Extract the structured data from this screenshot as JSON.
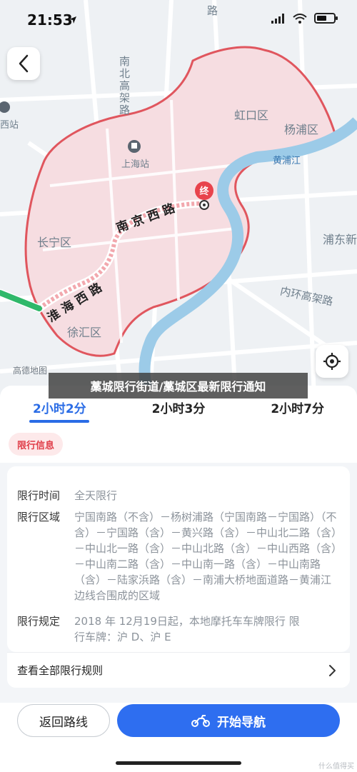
{
  "status_bar": {
    "time": "21:53"
  },
  "map": {
    "labels": {
      "hongkou": "虹口区",
      "yangpu": "杨浦区",
      "changning": "长宁区",
      "xuhui": "徐汇区",
      "pudong": "浦东新",
      "shanghai_station": "上海站",
      "huangpu_river": "黄浦江",
      "west_station": "西站",
      "inner_ring": "内环高架路",
      "north_south": "南北高架路",
      "top_road": "路"
    },
    "road_labels": {
      "nanjing": "南京西路",
      "huaihai": "淮海西路"
    },
    "end_marker": "终",
    "brand": "高德地图"
  },
  "banner": "藁城限行街道/藁城区最新限行通知",
  "route_tabs": [
    {
      "label": "2小时2分",
      "active": true
    },
    {
      "label": "2小时3分",
      "active": false
    },
    {
      "label": "2小时7分",
      "active": false
    }
  ],
  "info_pill": "限行信息",
  "restriction": {
    "time_label": "限行时间",
    "time_value": "全天限行",
    "area_label": "限行区域",
    "area_value": "宁国南路（不含）－杨树浦路（宁国南路－宁国路）（不含）－宁国路（含）－黄兴路（含）－中山北二路（含）－中山北一路（含）－中山北路（含）－中山西路（含）－中山南二路（含）－中山南一路（含）－中山南路（含）－陆家浜路（含）－南浦大桥地面道路－黄浦江边线合围成的区域",
    "rule_label": "限行规定",
    "rule_value": "2018 年 12月19日起，本地摩托车车牌限行 限行车牌：沪 D、沪 E"
  },
  "rules_link": "查看全部限行规则",
  "buttons": {
    "back_route": "返回路线",
    "start_nav": "开始导航"
  },
  "watermark": "什么值得买",
  "colors": {
    "accent": "#2e6ef0",
    "restricted_fill": "#f6dde1",
    "restricted_border": "#e0565e"
  }
}
